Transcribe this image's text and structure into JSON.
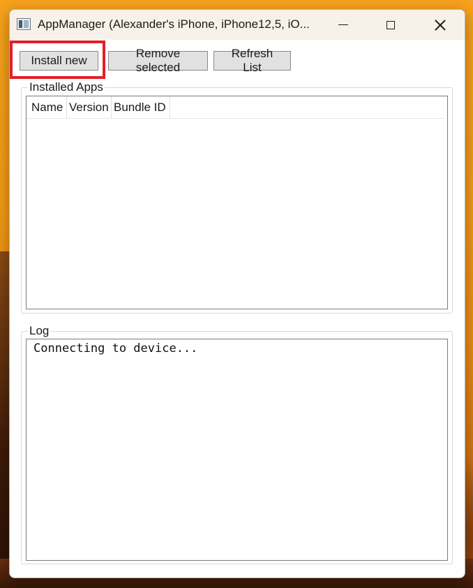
{
  "window": {
    "title": "AppManager (Alexander's iPhone, iPhone12,5, iO...",
    "icon": "app-window-icon"
  },
  "title_controls": {
    "minimize_icon": "minimize-icon",
    "maximize_icon": "maximize-icon",
    "close_icon": "close-icon"
  },
  "toolbar": {
    "install_label": "Install new",
    "remove_label": "Remove selected",
    "refresh_label": "Refresh List",
    "highlight_color": "#e0202a"
  },
  "installed_apps": {
    "group_label": "Installed Apps",
    "columns": [
      "Name",
      "Version",
      "Bundle ID"
    ],
    "rows": []
  },
  "log": {
    "group_label": "Log",
    "text": "Connecting to device..."
  }
}
